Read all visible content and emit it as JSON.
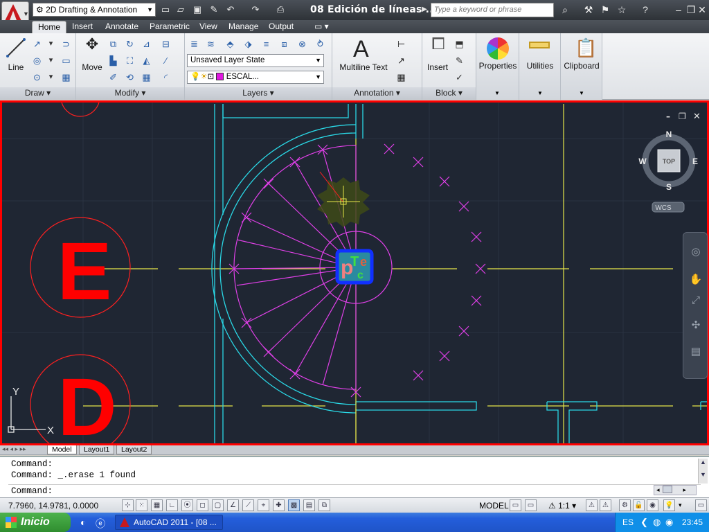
{
  "title_bar": {
    "workspace": "2D Drafting & Annotation",
    "document_title": "08 Edición de líneas ...",
    "search_placeholder": "Type a keyword or phrase"
  },
  "tabs": [
    "Home",
    "Insert",
    "Annotate",
    "Parametric",
    "View",
    "Manage",
    "Output"
  ],
  "active_tab": "Home",
  "ribbon": {
    "draw": {
      "title": "Draw",
      "line_label": "Line"
    },
    "modify": {
      "title": "Modify",
      "move_label": "Move"
    },
    "layers": {
      "title": "Layers",
      "layer_state": "Unsaved Layer State",
      "current_layer": "ESCAL..."
    },
    "annotation": {
      "title": "Annotation",
      "mtext_label": "Multiline Text"
    },
    "block": {
      "title": "Block",
      "insert_label": "Insert"
    },
    "properties_label": "Properties",
    "utilities_label": "Utilities",
    "clipboard_label": "Clipboard"
  },
  "viewcube": {
    "n": "N",
    "s": "S",
    "e": "E",
    "w": "W",
    "face": "TOP",
    "ucs": "WCS"
  },
  "drawing": {
    "bubble_top": "E",
    "bubble_bottom": "D",
    "logo_p": "p",
    "logo_t": "T",
    "logo_e": "e",
    "logo_c": "c"
  },
  "ucs_icon": {
    "x": "X",
    "y": "Y"
  },
  "layout_tabs": [
    "Model",
    "Layout1",
    "Layout2"
  ],
  "command_lines": [
    "Command:",
    "Command:  _.erase 1 found",
    "Command:"
  ],
  "status": {
    "coords": "7.7960, 14.9781, 0.0000",
    "model": "MODEL",
    "scale": "1:1"
  },
  "taskbar": {
    "start": "Inicio",
    "task": "AutoCAD 2011 - [08 ...",
    "lang": "ES",
    "time": "23:45"
  },
  "colors": {
    "viewport_bg": "#1f2633",
    "border": "#ff0000",
    "cyan": "#2ad8e6",
    "magenta": "#e040e8",
    "yellow": "#e6e64a",
    "red": "#ff0000"
  }
}
